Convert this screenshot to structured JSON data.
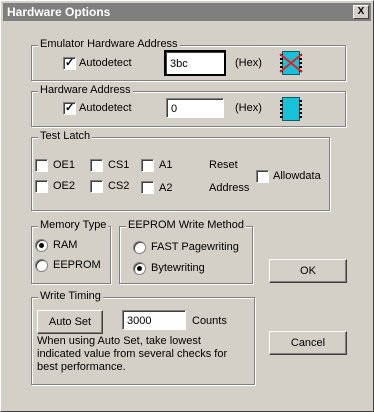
{
  "window": {
    "title": "Hardware Options",
    "close_label": "X"
  },
  "emulator": {
    "legend": "Emulator Hardware Address",
    "autodetect_label": "Autodetect",
    "autodetect_checked": true,
    "value": "3bc",
    "unit": "(Hex)"
  },
  "hardware": {
    "legend": "Hardware Address",
    "autodetect_label": "Autodetect",
    "autodetect_checked": true,
    "value": "0",
    "unit": "(Hex)"
  },
  "latch": {
    "legend": "Test Latch",
    "items": [
      "OE1",
      "CS1",
      "A1",
      "OE2",
      "CS2",
      "A2"
    ],
    "reset_label": "Reset",
    "address_label": "Address",
    "allowdata_label": "Allowdata"
  },
  "memory": {
    "legend": "Memory Type",
    "options": [
      "RAM",
      "EEPROM"
    ],
    "selected": "RAM"
  },
  "eeprom": {
    "legend": "EEPROM Write Method",
    "options": [
      "FAST Pagewriting",
      "Bytewriting"
    ],
    "selected": "Bytewriting"
  },
  "timing": {
    "legend": "Write Timing",
    "autoset_label": "Auto Set",
    "value": "3000",
    "unit": "Counts",
    "note": "When using Auto Set, take lowest indicated value from several checks for best performance."
  },
  "buttons": {
    "ok": "OK",
    "cancel": "Cancel"
  },
  "colors": {
    "title_bar": "#7f7f7f",
    "dialog_bg": "#d4d0c8",
    "chip": "#19c1d8",
    "chip_alert": "#e02020"
  }
}
